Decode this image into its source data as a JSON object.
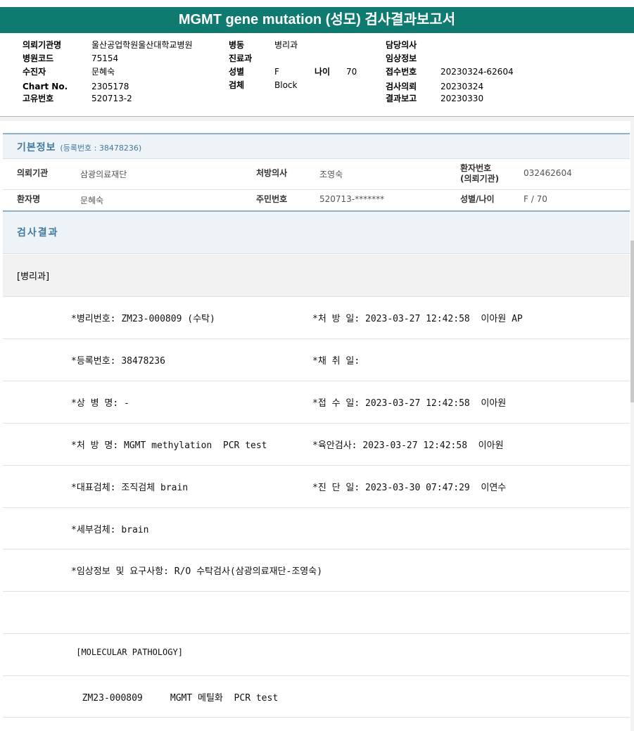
{
  "report": {
    "title": "MGMT gene mutation (성모) 검사결과보고서"
  },
  "header": {
    "fields": [
      {
        "label": "의뢰기관명",
        "value": "울산공업학원울산대학교병원"
      },
      {
        "label": "병원코드",
        "value": "75154"
      },
      {
        "label": "수진자",
        "value": "문혜숙"
      },
      {
        "label": "Chart No.",
        "value": "2305178"
      },
      {
        "label": "고유번호",
        "value": "520713-2"
      },
      {
        "label": "병동",
        "value": "병리과"
      },
      {
        "label": "진료과",
        "value": ""
      },
      {
        "label": "성별",
        "value": "F"
      },
      {
        "label": "나이",
        "value": "70"
      },
      {
        "label": "검체",
        "value": "Block"
      },
      {
        "label": "담당의사",
        "value": ""
      },
      {
        "label": "임상정보",
        "value": ""
      },
      {
        "label": "접수번호",
        "value": "20230324-62604"
      },
      {
        "label": "검사의뢰",
        "value": "20230324"
      },
      {
        "label": "결과보고",
        "value": "20230330"
      }
    ]
  },
  "basic_info": {
    "title": "기본정보",
    "subtitle": "(등록번호 : 38478236)",
    "rows": [
      [
        {
          "label": "의뢰기관",
          "value": "삼광의료재단"
        },
        {
          "label": "처방의사",
          "value": "조영숙"
        },
        {
          "label": "환자번호\n(의뢰기관)",
          "value": "032462604"
        }
      ],
      [
        {
          "label": "환자명",
          "value": "문혜숙"
        },
        {
          "label": "주민번호",
          "value": "520713-*******"
        },
        {
          "label": "성별/나이",
          "value": "F / 70"
        }
      ]
    ]
  },
  "results": {
    "title": "검사결과",
    "department": "[병리과]",
    "lines": [
      {
        "left": "*병리번호: ZM23-000809 (수탁)",
        "right": "*처 방 일: 2023-03-27 12:42:58  이아원 AP"
      },
      {
        "left": "*등록번호: 38478236",
        "right": "*채 취 일:"
      },
      {
        "left": "*상 병 명: -",
        "right": "*접 수 일: 2023-03-27 12:42:58  이아원"
      },
      {
        "left": "*처 방 명: MGMT methylation  PCR test",
        "right": "*육안검사: 2023-03-27 12:42:58  이아원"
      },
      {
        "left": "*대표검체: 조직검체 brain",
        "right": "*진 단 일: 2023-03-30 07:47:29  이연수"
      },
      {
        "left": "*세부검체: brain",
        "right": ""
      },
      {
        "left": "*임상정보 및 요구사항: R/O 수탁검사(삼광의료재단-조영숙)",
        "right": ""
      },
      {
        "left": "",
        "right": ""
      },
      {
        "left": " [MOLECULAR PATHOLOGY]",
        "right": ""
      },
      {
        "left": "  ZM23-000809     MGMT 메틸화  PCR test",
        "right": ""
      }
    ]
  }
}
